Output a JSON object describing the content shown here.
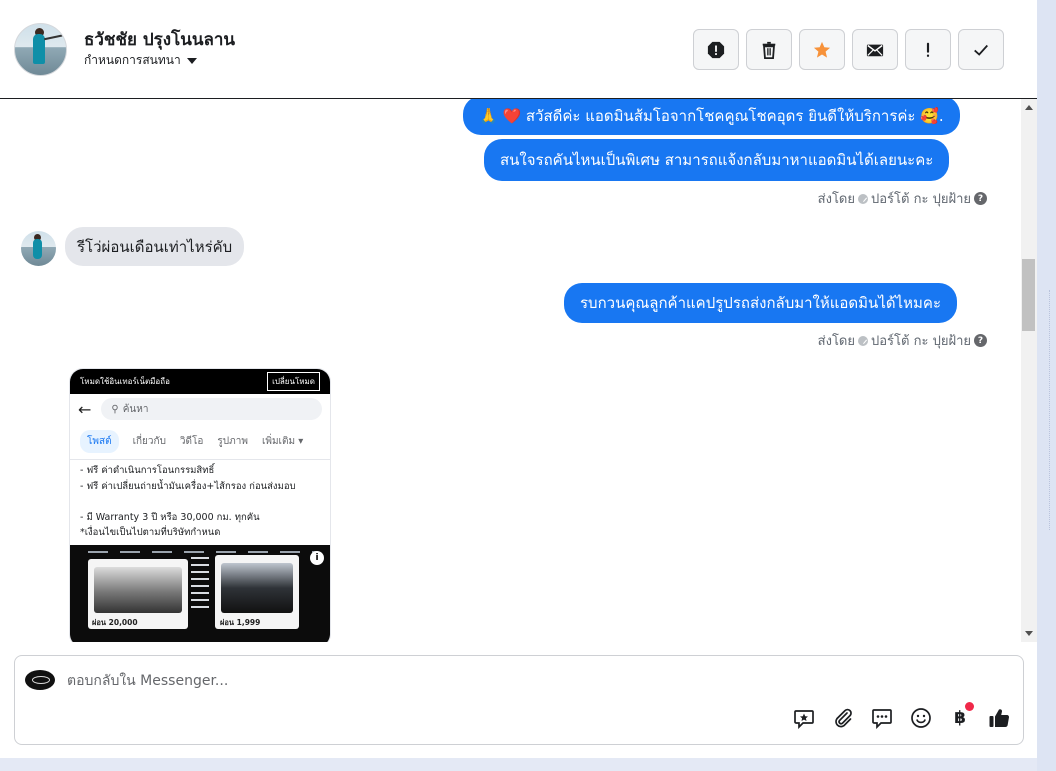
{
  "header": {
    "contact_name": "ธวัชชัย ปรุงโนนลาน",
    "assign_label": "กำหนดการสนทนา",
    "actions": [
      {
        "icon": "alert-octagon-icon",
        "name": "mark-spam-button"
      },
      {
        "icon": "trash-icon",
        "name": "delete-button"
      },
      {
        "icon": "star-icon",
        "name": "star-button"
      },
      {
        "icon": "envelope-icon",
        "name": "mark-unread-button"
      },
      {
        "icon": "exclamation-icon",
        "name": "follow-up-button"
      },
      {
        "icon": "check-icon",
        "name": "mark-done-button"
      }
    ],
    "star_color": "#f7923a"
  },
  "messages": {
    "out1": "🙏 ❤️ สวัสดีค่ะ แอดมินส้มโอจากโชคคูณโชคอุดร ยินดีให้บริการค่ะ 🥰.",
    "out2": "สนใจรถคันไหนเป็นพิเศษ สามารถแจ้งกลับมาหาแอดมินได้เลยนะคะ",
    "sent_by_1": {
      "prefix": "ส่งโดย",
      "name": "ปอร์โต้ กะ ปุยฝ้าย"
    },
    "in1": "รีโว่ผ่อนเดือนเท่าไหร่คับ",
    "out3": "รบกวนคุณลูกค้าแคปรูปรถส่งกลับมาให้แอดมินได้ไหมคะ",
    "sent_by_2": {
      "prefix": "ส่งโดย",
      "name": "ปอร์โต้ กะ ปุยฝ้าย"
    }
  },
  "attachment": {
    "top_text": "โหมดใช้อินเทอร์เน็ตมือถือ",
    "mode_button": "เปลี่ยนโหมด",
    "search_placeholder": "ค้นหา",
    "tabs": [
      "โพสต์",
      "เกี่ยวกับ",
      "วิดีโอ",
      "รูปภาพ",
      "เพิ่มเติม ▾"
    ],
    "lines": [
      "- ฟรี ค่าดำเนินการโอนกรรมสิทธิ์",
      "- ฟรี ค่าเปลี่ยนถ่ายน้ำมันเครื่อง+ไส้กรอง ก่อนส่งมอบ",
      "",
      "- มี Warranty 3 ปี หรือ 30,000 กม. ทุกคัน",
      "*เงื่อนไขเป็นไปตามที่บริษัทกำหนด"
    ],
    "price_left": "ผ่อน 20,000",
    "price_right": "ผ่อน 1,999"
  },
  "composer": {
    "placeholder": "ตอบกลับใน Messenger...",
    "value": "",
    "tools": [
      "saved-reply-icon",
      "attachment-icon",
      "chat-bubbles-icon",
      "emoji-icon",
      "baht-payment-icon",
      "thumbs-up-icon"
    ],
    "baht_symbol": "฿"
  },
  "colors": {
    "accent": "#1877f2",
    "incoming_bubble": "#e4e6eb",
    "badge": "#f02849"
  }
}
